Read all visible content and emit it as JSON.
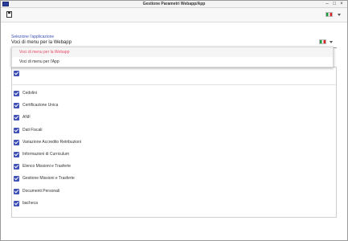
{
  "window": {
    "title": "Gestione Parametri Webapp/App"
  },
  "selector": {
    "label": "Selezione l'applicazione",
    "value": "Voci di menu per la Webapp",
    "options": [
      {
        "label": "Voci di menu per la Webapp",
        "active": true
      },
      {
        "label": "Voci di menu per l'App",
        "active": false
      }
    ]
  },
  "items": [
    {
      "label": "Cedolini",
      "checked": true
    },
    {
      "label": "Certificazione Unica",
      "checked": true
    },
    {
      "label": "ANF",
      "checked": true
    },
    {
      "label": "Dati Fiscali",
      "checked": true
    },
    {
      "label": "Variazione Accredito Retribuzioni",
      "checked": true
    },
    {
      "label": "Informazioni di Curriculum",
      "checked": true
    },
    {
      "label": "Elenco Missioni e Trasferte",
      "checked": true
    },
    {
      "label": "Gestione Missioni e Trasferte",
      "checked": true
    },
    {
      "label": "Documenti Personali",
      "checked": true
    },
    {
      "label": "bacheca",
      "checked": true
    }
  ],
  "colors": {
    "accent": "#3f51b5",
    "active_option": "#e84a6a"
  },
  "icons": {
    "app": "app-icon",
    "save": "save-icon",
    "flag": "italy-flag-icon"
  }
}
